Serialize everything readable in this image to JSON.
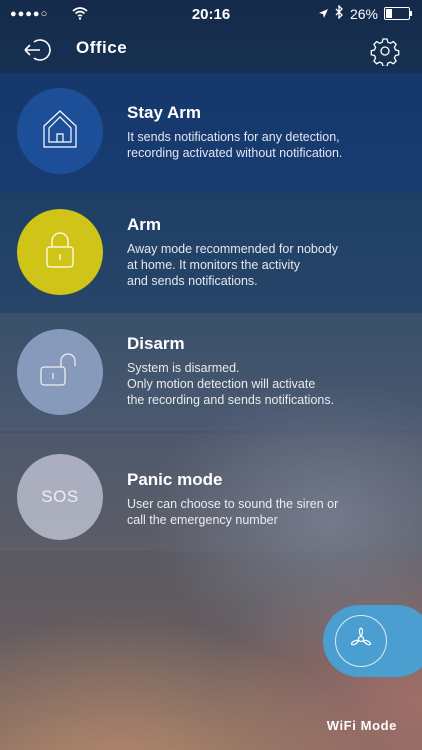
{
  "status_bar": {
    "signal_dots": "●●●●○",
    "time": "20:16",
    "battery": "26%",
    "battery_level": 0.26
  },
  "header": {
    "title": "Office",
    "back_icon": "back-arrow-circle-icon",
    "settings_icon": "gear-icon"
  },
  "modes": [
    {
      "label": "Stay Arm",
      "description": "It sends notifications for any detection,\nrecording activated without notification.",
      "icon": "house-icon",
      "color": "#1d4f99"
    },
    {
      "label": "Arm",
      "description": "Away mode recommended for nobody\nat home. It monitors the activity\nand sends notifications.",
      "icon": "padlock-closed-icon",
      "color": "#cfc417"
    },
    {
      "label": "Disarm",
      "description": "System is disarmed.\nOnly motion detection will activate\nthe recording and sends notifications.",
      "icon": "padlock-open-icon",
      "color": "#8fa2c4"
    },
    {
      "label": "Panic mode",
      "description": "User can choose to sound the siren or\ncall the emergency number",
      "icon_text": "SOS",
      "color": "#b4b8c8"
    }
  ],
  "fab": {
    "icon": "fan-icon",
    "color": "#4a9fd0"
  },
  "footer": {
    "mode_label": "WiFi  Mode"
  }
}
